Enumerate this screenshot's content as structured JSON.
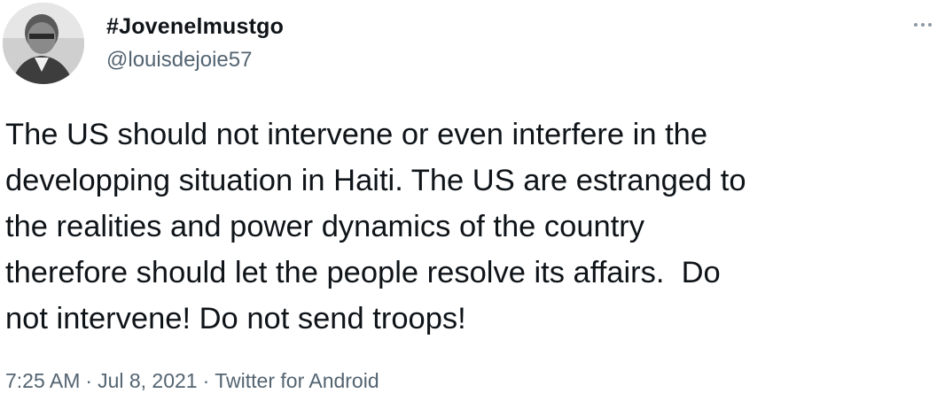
{
  "tweet": {
    "display_name": "#Jovenelmustgo",
    "handle": "@louisdejoie57",
    "more_icon": "ellipsis-icon",
    "text": "The US should not intervene or even interfere in the\ndevelopping situation in Haiti. The US are estranged to\nthe realities and power dynamics of the country\ntherefore should let the people resolve its affairs.  Do\nnot intervene! Do not send troops!",
    "time": "7:25 AM",
    "separator": "·",
    "date": "Jul 8, 2021",
    "source": "Twitter for Android"
  },
  "colors": {
    "text": "#0f1419",
    "secondary": "#536471",
    "background": "#ffffff"
  }
}
